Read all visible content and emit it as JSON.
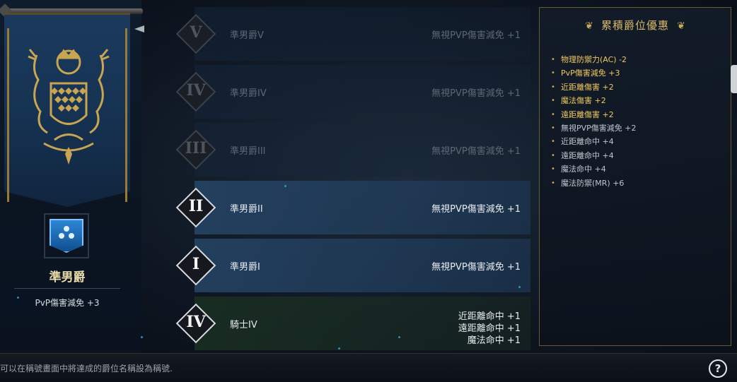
{
  "left": {
    "rank_name": "準男爵",
    "rank_bonus": "PvP傷害減免 +3"
  },
  "rows": [
    {
      "numeral": "V",
      "title": "準男爵V",
      "effect": "無視PVP傷害減免 +1",
      "state": "locked"
    },
    {
      "numeral": "IV",
      "title": "準男爵IV",
      "effect": "無視PVP傷害減免 +1",
      "state": "locked"
    },
    {
      "numeral": "III",
      "title": "準男爵III",
      "effect": "無視PVP傷害減免 +1",
      "state": "locked"
    },
    {
      "numeral": "II",
      "title": "準男爵II",
      "effect": "無視PVP傷害減免 +1",
      "state": "achieved"
    },
    {
      "numeral": "I",
      "title": "準男爵I",
      "effect": "無視PVP傷害減免 +1",
      "state": "achieved"
    },
    {
      "numeral": "IV",
      "title": "騎士IV",
      "effects": [
        "近距離命中 +1",
        "遠距離命中 +1",
        "魔法命中 +1"
      ],
      "state": "knight"
    }
  ],
  "panel": {
    "title": "累積爵位優惠",
    "benefits": [
      {
        "text": "物理防禦力(AC) -2",
        "highlight": true
      },
      {
        "text": "PvP傷害減免 +3",
        "highlight": true
      },
      {
        "text": "近距離傷害 +2",
        "highlight": true
      },
      {
        "text": "魔法傷害 +2",
        "highlight": true
      },
      {
        "text": "遠距離傷害 +2",
        "highlight": true
      },
      {
        "text": "無視PVP傷害減免 +2",
        "highlight": false
      },
      {
        "text": "近距離命中 +4",
        "highlight": false
      },
      {
        "text": "遠距離命中 +4",
        "highlight": false
      },
      {
        "text": "魔法命中 +4",
        "highlight": false
      },
      {
        "text": "魔法防禦(MR) +6",
        "highlight": false
      }
    ]
  },
  "footer": {
    "hint": "可以在稱號畫面中將達成的爵位名稱設為稱號.",
    "help_label": "?"
  },
  "icons": {
    "crest": "heraldic-crest-icon",
    "emblem": "rank-shield-icon",
    "help": "question-mark-icon"
  },
  "colors": {
    "gold": "#d8b86a",
    "highlight": "#f0c860",
    "banner_blue": "#1b3a5e",
    "emblem_blue": "#2e86d6"
  }
}
